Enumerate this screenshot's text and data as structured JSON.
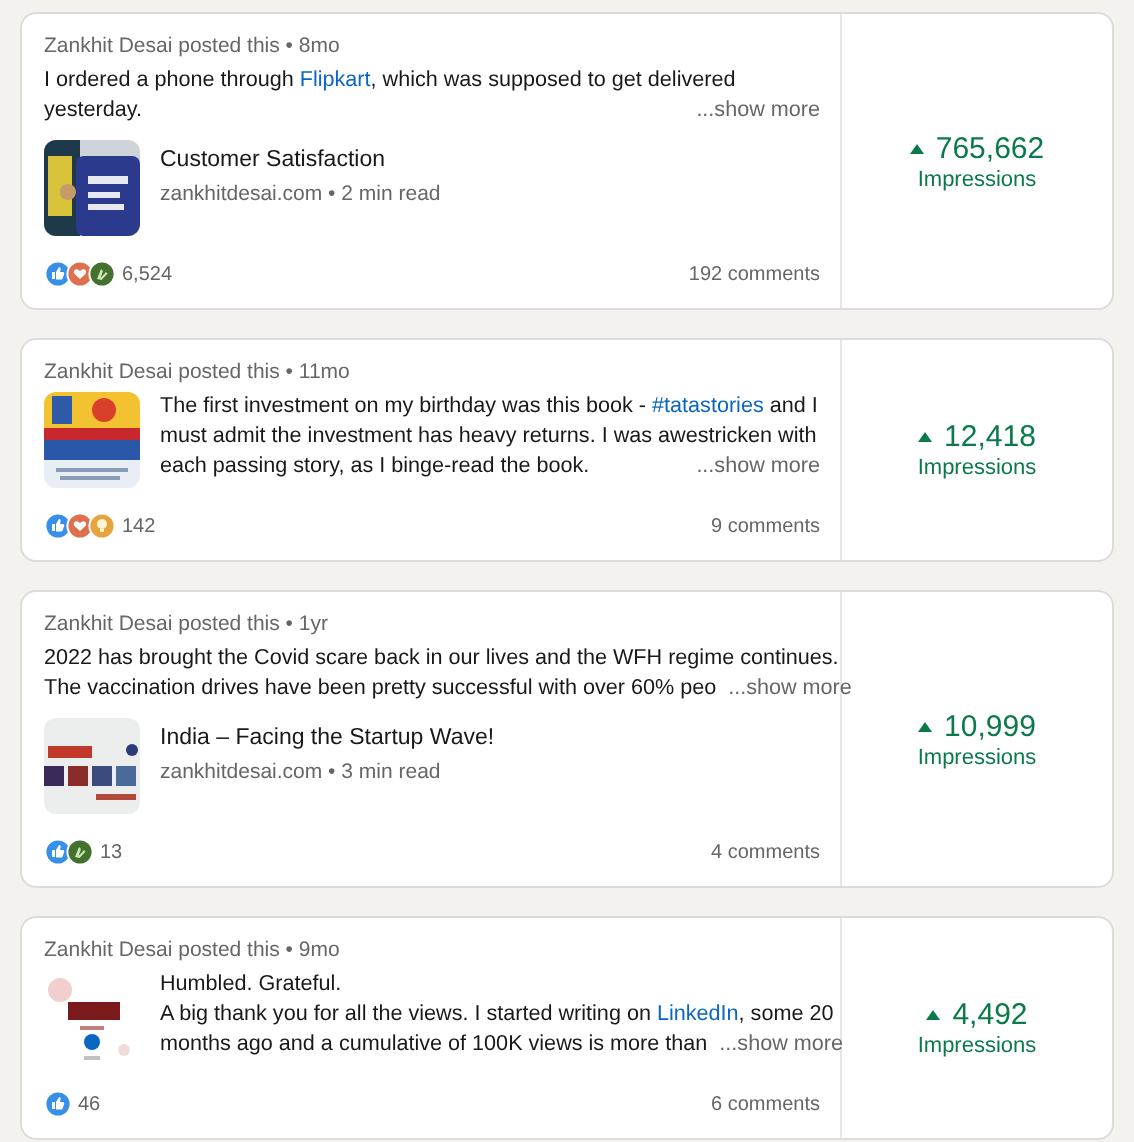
{
  "posts": [
    {
      "header": "Zankhit Desai posted this • 8mo",
      "lines": [
        [
          {
            "kind": "plain",
            "text": "I ordered a phone through "
          },
          {
            "kind": "link",
            "text": "Flipkart"
          },
          {
            "kind": "plain",
            "text": ", which was supposed to get delivered"
          }
        ],
        [
          {
            "kind": "plain",
            "text": "yesterday."
          }
        ]
      ],
      "show_more": "...show more",
      "thumbnail": {
        "kind": "picture"
      },
      "article": {
        "title": "Customer Satisfaction",
        "source": "zankhitdesai.com • 2 min read"
      },
      "reactions": [
        {
          "kind": "like"
        },
        {
          "kind": "love"
        },
        {
          "kind": "celebrate"
        }
      ],
      "reaction_count": "6,524",
      "comments": "192 comments",
      "impressions": "765,662",
      "impressions_label": "Impressions"
    },
    {
      "header": "Zankhit Desai posted this • 11mo",
      "lines": [
        [
          {
            "kind": "plain",
            "text": "The first investment on my birthday was this book -  "
          },
          {
            "kind": "link",
            "text": "#tatastories"
          },
          {
            "kind": "plain",
            "text": "  and I"
          }
        ],
        [
          {
            "kind": "plain",
            "text": "must admit the investment has heavy returns. I was awestricken with"
          }
        ],
        [
          {
            "kind": "plain",
            "text": "each passing story, as I binge-read the book."
          }
        ]
      ],
      "show_more": "...show more",
      "thumbnail": {
        "kind": "picture"
      },
      "reactions": [
        {
          "kind": "like"
        },
        {
          "kind": "love"
        },
        {
          "kind": "insightful"
        }
      ],
      "reaction_count": "142",
      "comments": "9 comments",
      "impressions": "12,418",
      "impressions_label": "Impressions"
    },
    {
      "header": "Zankhit Desai posted this • 1yr",
      "lines": [
        [
          {
            "kind": "plain",
            "text": "2022 has brought the Covid scare back in our lives and the WFH regime continues."
          }
        ],
        [
          {
            "kind": "plain",
            "text": "The vaccination drives have been pretty successful with over 60% peo"
          }
        ]
      ],
      "show_more": "...show more",
      "thumbnail": {
        "kind": "picture"
      },
      "article": {
        "title": "India – Facing the Startup Wave!",
        "source": "zankhitdesai.com • 3 min read"
      },
      "reactions": [
        {
          "kind": "like"
        },
        {
          "kind": "celebrate"
        }
      ],
      "reaction_count": "13",
      "comments": "4 comments",
      "impressions": "10,999",
      "impressions_label": "Impressions"
    },
    {
      "header": "Zankhit Desai posted this • 9mo",
      "lines": [
        [
          {
            "kind": "plain",
            "text": "Humbled. Grateful."
          }
        ],
        [
          {
            "kind": "plain",
            "text": "A big thank you for all the views. I started writing on "
          },
          {
            "kind": "link",
            "text": "LinkedIn"
          },
          {
            "kind": "plain",
            "text": ", some 20"
          }
        ],
        [
          {
            "kind": "plain",
            "text": "months ago and a cumulative of 100K views is more than"
          }
        ]
      ],
      "show_more": "...show more",
      "thumbnail": {
        "kind": "picture"
      },
      "reactions": [
        {
          "kind": "like"
        }
      ],
      "reaction_count": "46",
      "comments": "6 comments",
      "impressions": "4,492",
      "impressions_label": "Impressions"
    }
  ]
}
